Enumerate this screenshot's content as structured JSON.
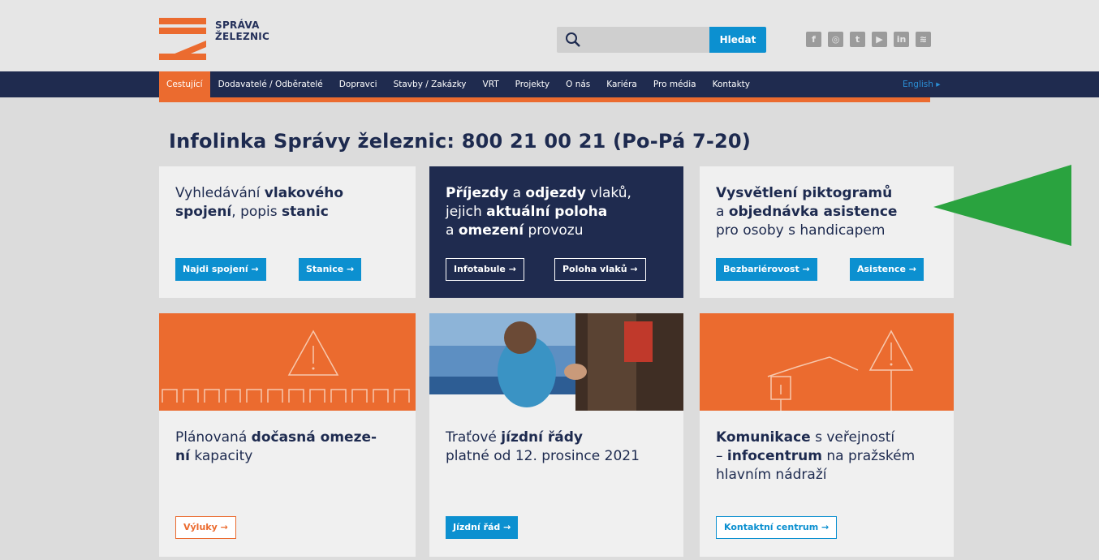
{
  "header": {
    "logo_line1": "SPRÁVA",
    "logo_line2": "ŽELEZNIC",
    "search_placeholder": "",
    "search_button": "Hledat",
    "social": [
      {
        "label": "f",
        "icon": "facebook-icon"
      },
      {
        "label": "◎",
        "icon": "instagram-icon"
      },
      {
        "label": "t",
        "icon": "twitter-icon"
      },
      {
        "label": "▶",
        "icon": "youtube-icon"
      },
      {
        "label": "in",
        "icon": "linkedin-icon"
      },
      {
        "label": "≋",
        "icon": "spotify-icon"
      }
    ]
  },
  "nav": {
    "items": [
      "Cestující",
      "Dodavatelé / Odběratelé",
      "Dopravci",
      "Stavby / Zakázky",
      "VRT",
      "Projekty",
      "O nás",
      "Kariéra",
      "Pro média",
      "Kontakty"
    ],
    "english": "English ▸"
  },
  "infoline": "Infolinka Správy železnic: 800 21 00 21 (Po-Pá 7-20)",
  "cards": {
    "c1": {
      "t1": "Vyhledávání ",
      "b1": "vlakového",
      "b2": "spojení",
      "t2": ", popis ",
      "b3": "stanic",
      "btn1": "Najdi spojení →",
      "btn2": "Stanice →"
    },
    "c2": {
      "b1": "Příjezdy",
      "t1": " a ",
      "b2": "odjezdy",
      "t2": " vlaků,",
      "t3": "jejich ",
      "b3": "aktuální poloha",
      "t4": "a ",
      "b4": "omezení",
      "t5": " provozu",
      "btn1": "Infotabule →",
      "btn2": "Poloha vlaků →"
    },
    "c3": {
      "b1": "Vysvětlení piktogramů",
      "t1": "a ",
      "b2": "objednávka asistence",
      "t2": "pro osoby s handicapem",
      "btn1": "Bezbariérovost →",
      "btn2": "Asistence →"
    },
    "c4": {
      "t1": "Plánovaná ",
      "b1": "dočasná omeze-",
      "b2": "ní",
      "t2": " kapacity",
      "btn1": "Výluky →"
    },
    "c5": {
      "t1": "Traťové ",
      "b1": "jízdní řády",
      "t2": "platné od 12. prosince 2021",
      "btn1": "Jízdní řád →"
    },
    "c6": {
      "b1": "Komunikace",
      "t1": " s veřejností",
      "t2": "– ",
      "b2": "infocentrum",
      "t3": " na pražském",
      "t4": "hlavním nádraží",
      "btn1": "Kontaktní centrum →"
    }
  },
  "colors": {
    "navy": "#1f2b4f",
    "orange": "#eb6b2f",
    "blue": "#0c90d0",
    "green_arrow": "#2aa33f"
  }
}
